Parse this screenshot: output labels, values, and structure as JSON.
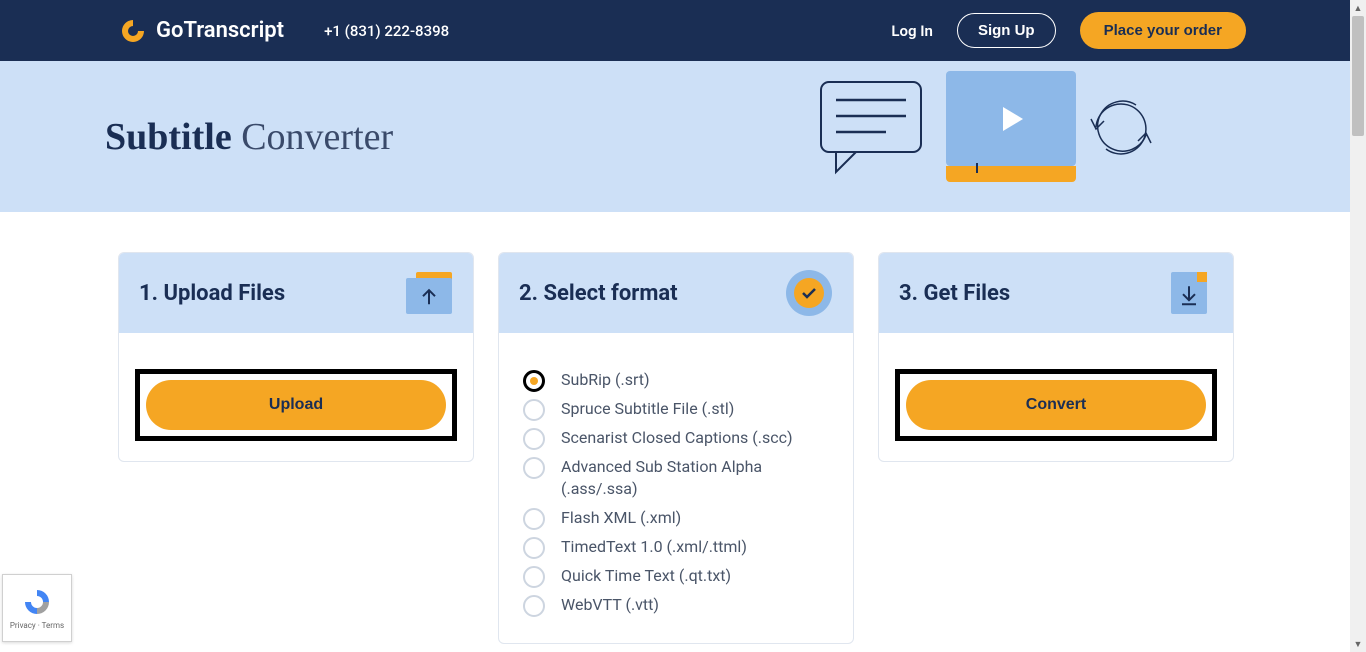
{
  "header": {
    "logo_text": "GoTranscript",
    "phone": "+1 (831) 222-8398",
    "login": "Log In",
    "signup": "Sign Up",
    "place_order": "Place your order"
  },
  "hero": {
    "title_bold": "Subtitle ",
    "title_light": "Converter"
  },
  "cards": {
    "upload": {
      "title": "1. Upload Files",
      "button": "Upload"
    },
    "select": {
      "title": "2. Select format",
      "options": [
        {
          "label": "SubRip (.srt)",
          "selected": true
        },
        {
          "label": "Spruce Subtitle File (.stl)",
          "selected": false
        },
        {
          "label": "Scenarist Closed Captions (.scc)",
          "selected": false
        },
        {
          "label": "Advanced Sub Station Alpha (.ass/.ssa)",
          "selected": false
        },
        {
          "label": "Flash XML (.xml)",
          "selected": false
        },
        {
          "label": "TimedText 1.0 (.xml/.ttml)",
          "selected": false
        },
        {
          "label": "Quick Time Text (.qt.txt)",
          "selected": false
        },
        {
          "label": "WebVTT (.vtt)",
          "selected": false
        }
      ]
    },
    "get": {
      "title": "3. Get Files",
      "button": "Convert"
    }
  },
  "recaptcha": {
    "text": "Privacy · Terms"
  }
}
